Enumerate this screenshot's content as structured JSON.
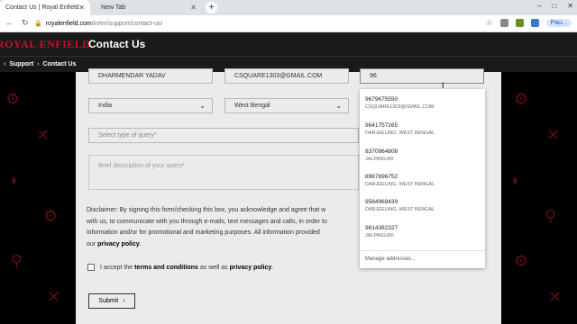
{
  "browser": {
    "tabs": [
      {
        "title": "Contact Us | Royal Enfield",
        "active": true
      },
      {
        "title": "New Tab",
        "active": false
      }
    ],
    "newtab_glyph": "+",
    "url_host": "royalenfield.com",
    "url_path": "/in/en/support/contact-us/",
    "profile_label": "Pau..."
  },
  "site": {
    "logo": "ROYAL ENFIELD",
    "page_title": "Contact Us",
    "breadcrumb": [
      "Support",
      "Contact Us"
    ]
  },
  "form": {
    "name_value": "DHARMENDAR YADAV",
    "email_value": "CSQUARE1303@GMAIL.COM",
    "phone_value": "96",
    "country_value": "India",
    "state_value": "West Bengal",
    "query_type_placeholder": "Select type of query*",
    "description_placeholder": "Brief description of your query*",
    "disclaimer_lines": [
      "Disclaimer: By signing this form/checking this box, you acknowledge and agree that w",
      "with us, to communicate with you through e-mails, text messages and calls, in order to",
      "information and/or for promotional and marketing purposes. All information provided"
    ],
    "disclaimer_our": "our",
    "disclaimer_link": "privacy policy",
    "disclaimer_end": ".",
    "consent_prefix": "I accept the",
    "consent_terms": "terms and conditions",
    "consent_mid": "as well as",
    "consent_privacy": "privacy policy",
    "consent_end": ".",
    "submit_label": "Submit"
  },
  "autocomplete": {
    "options": [
      {
        "phone": "9679675550",
        "sub": "CSQUARE1303@GMAIL.COM"
      },
      {
        "phone": "9641757165",
        "sub": "DARJEELING, WEST BENGAL"
      },
      {
        "phone": "8370964808",
        "sub": "JALPAIGURI"
      },
      {
        "phone": "8967896752",
        "sub": "DARJEELING, WEST BENGAL"
      },
      {
        "phone": "9564969439",
        "sub": "DARJEELING, WEST BENGAL"
      },
      {
        "phone": "9614382327",
        "sub": "JALPAIGURI"
      }
    ],
    "manage_label": "Manage addresses..."
  },
  "colors": {
    "brand_red": "#c8102e",
    "header_bg": "#1a1a1a",
    "panel_bg": "#ebebeb"
  }
}
